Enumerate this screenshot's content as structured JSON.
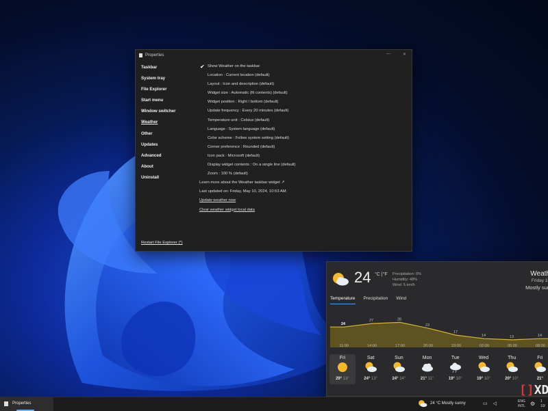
{
  "window": {
    "title": "Properties",
    "nav": [
      "Taskbar",
      "System tray",
      "File Explorer",
      "Start menu",
      "Window switcher",
      "Weather",
      "Other",
      "Updates",
      "Advanced",
      "About",
      "Uninstall"
    ],
    "active_nav": "Weather",
    "restart_label": "Restart File Explorer (*)",
    "options": [
      "Show Weather on the taskbar",
      "Location : Current location (default)",
      "Layout : Icon and description (default)",
      "Widget size : Automatic (fit contents) (default)",
      "Widget position : Right / bottom (default)",
      "Update frequency : Every 20 minutes (default)",
      "Temperature unit : Celsius (default)",
      "Language : System language (default)",
      "Color scheme : Follow system setting (default)",
      "Corner preference : Rounded (default)",
      "Icon pack : Microsoft (default)",
      "Display widget contents : On a single line (default)",
      "Zoom : 100 % (default)"
    ],
    "learn_more": "Learn more about the Weather taskbar widget ↗",
    "last_updated": "Last updated on: Friday, May 10, 2024, 10:53 AM.",
    "update_now": "Update weather now",
    "clear_data": "Clear weather widget local data"
  },
  "weather": {
    "temp": "24",
    "unit": "°C |°F",
    "precipitation": "Precipitation: 0%",
    "humidity": "Humidity: 48%",
    "wind": "Wind: 5 km/h",
    "title": "Weath",
    "day": "Friday 10",
    "condition": "Mostly sun",
    "tabs": [
      "Temperature",
      "Precipitation",
      "Wind"
    ],
    "active_tab": "Temperature",
    "days": [
      {
        "name": "Fri",
        "hi": "29°",
        "lo": "13°",
        "icon": "sun-icon"
      },
      {
        "name": "Sat",
        "hi": "24°",
        "lo": "13°",
        "icon": "partly-sunny-icon"
      },
      {
        "name": "Sun",
        "hi": "24°",
        "lo": "14°",
        "icon": "partly-sunny-icon"
      },
      {
        "name": "Mon",
        "hi": "21°",
        "lo": "11°",
        "icon": "cloud-icon"
      },
      {
        "name": "Tue",
        "hi": "19°",
        "lo": "10°",
        "icon": "rain-icon"
      },
      {
        "name": "Wed",
        "hi": "19°",
        "lo": "10°",
        "icon": "partly-sunny-icon"
      },
      {
        "name": "Thu",
        "hi": "20°",
        "lo": "10°",
        "icon": "partly-sunny-icon"
      },
      {
        "name": "Fri",
        "hi": "21°",
        "lo": "",
        "icon": "partly-sunny-icon"
      }
    ]
  },
  "chart_data": {
    "type": "area",
    "x": [
      "11:00",
      "14:00",
      "17:00",
      "20:00",
      "23:00",
      "02:00",
      "05:00",
      "08:00"
    ],
    "values": [
      24,
      27,
      28,
      23,
      17,
      14,
      13,
      14
    ],
    "labels": [
      "24",
      "27",
      "28",
      "23",
      "17",
      "14",
      "13",
      "14"
    ],
    "colors": {
      "line": "#d8b534",
      "fill": "#5e5320"
    }
  },
  "taskbar": {
    "app_label": "Properties",
    "weather_text": "24 °C  Mostly sunny",
    "lang_1": "ENG",
    "lang_2": "INTL",
    "clock_1": "1",
    "clock_2": "10/"
  },
  "logo": {
    "text": "XDA"
  }
}
